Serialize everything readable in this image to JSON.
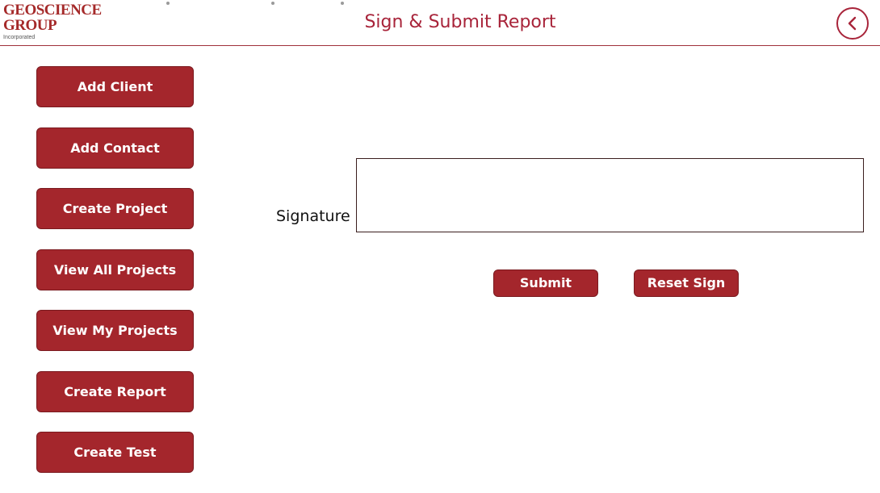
{
  "header": {
    "logo": {
      "line1": "GEOSCIENCE",
      "line2": "GROUP",
      "sub": "Incorporated",
      "color": "#a52a2a"
    },
    "title": "Sign & Submit Report",
    "back_icon": "chevron-left-icon",
    "accent_color": "#a8243a"
  },
  "sidebar": {
    "items": [
      {
        "label": "Add Client"
      },
      {
        "label": "Add Contact"
      },
      {
        "label": "Create Project"
      },
      {
        "label": "View All Projects"
      },
      {
        "label": "View My Projects"
      },
      {
        "label": "Create Report"
      },
      {
        "label": "Create Test"
      }
    ],
    "button_color": "#a4262c"
  },
  "main": {
    "signature_label": "Signature",
    "submit_label": "Submit",
    "reset_label": "Reset Sign"
  }
}
